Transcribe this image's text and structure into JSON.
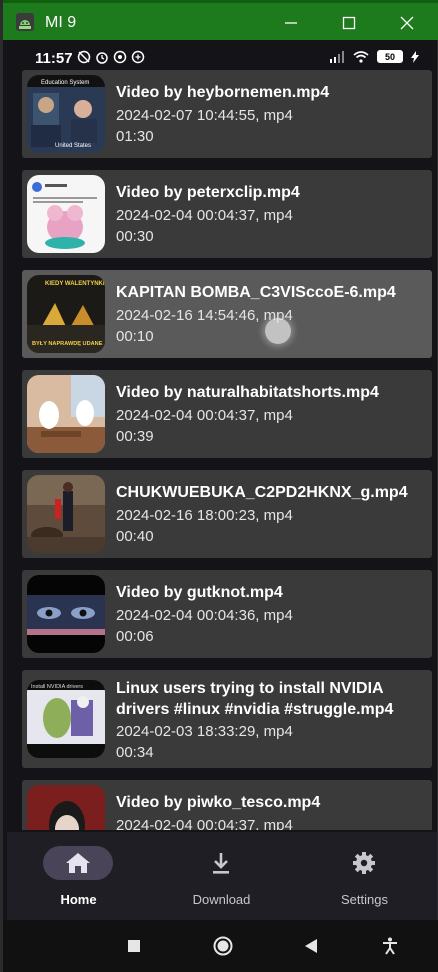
{
  "window": {
    "title": "MI 9"
  },
  "status_bar": {
    "time": "11:57",
    "battery": "50"
  },
  "items": [
    {
      "title": "Video by heybornemen.mp4",
      "meta": "2024-02-07 10:44:55, mp4",
      "duration": "01:30",
      "thumb_text": "Education System vs United States"
    },
    {
      "title": "Video by peterxclip.mp4",
      "meta": "2024-02-04 00:04:37, mp4",
      "duration": "00:30"
    },
    {
      "title": "KAPITAN BOMBA_C3VISccoE-6.mp4",
      "meta": "2024-02-16 14:54:46, mp4",
      "duration": "00:10",
      "thumb_text_top": "KIEDY WALENTYNKI",
      "thumb_text_bottom": "BYŁY NAPRAWDĘ UDANE"
    },
    {
      "title": "Video by naturalhabitatshorts.mp4",
      "meta": "2024-02-04 00:04:37, mp4",
      "duration": "00:39"
    },
    {
      "title": "CHUKWUEBUKA_C2PD2HKNX_g.mp4",
      "meta": "2024-02-16 18:00:23, mp4",
      "duration": "00:40"
    },
    {
      "title": "Video by gutknot.mp4",
      "meta": "2024-02-04 00:04:36, mp4",
      "duration": "00:06"
    },
    {
      "title": "Linux users trying to install NVIDIA drivers #linux #nvidia #struggle.mp4",
      "meta": "2024-02-03 18:33:29, mp4",
      "duration": "00:34",
      "thumb_text": "Install NVIDIA drivers"
    },
    {
      "title": "Video by piwko_tesco.mp4",
      "meta": "2024-02-04 00:04:37, mp4",
      "duration": ""
    }
  ],
  "bottom_nav": {
    "home": "Home",
    "download": "Download",
    "settings": "Settings"
  },
  "colors": {
    "titlebar": "#1d7a1d",
    "list_item": "#3a3a3a",
    "list_item_pressed": "#5a5a5a",
    "nav_active_pill": "#4a4458"
  }
}
